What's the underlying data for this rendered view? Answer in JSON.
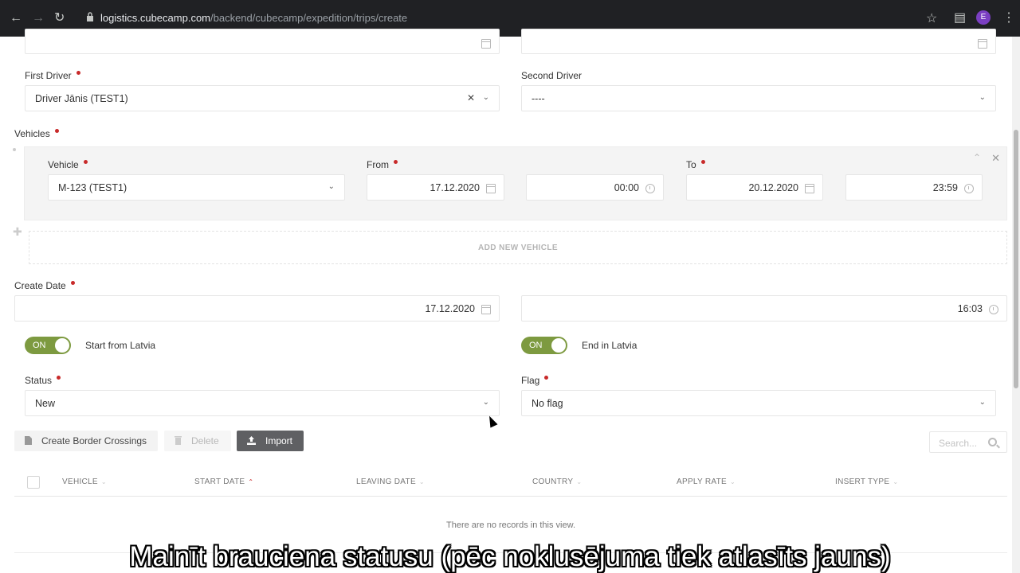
{
  "browser": {
    "url_host": "logistics.cubecamp.com",
    "url_path": "/backend/cubecamp/expedition/trips/create",
    "profile_initial": "E"
  },
  "form": {
    "first_driver": {
      "label": "First Driver",
      "value": "Driver Jānis (TEST1)"
    },
    "second_driver": {
      "label": "Second Driver",
      "value": "----"
    },
    "vehicles_label": "Vehicles",
    "vehicle": {
      "label": "Vehicle",
      "value": "M-123 (TEST1)"
    },
    "from": {
      "label": "From",
      "date": "17.12.2020",
      "time": "00:00"
    },
    "to": {
      "label": "To",
      "date": "20.12.2020",
      "time": "23:59"
    },
    "add_vehicle_label": "ADD NEW VEHICLE",
    "create_date": {
      "label": "Create Date",
      "date": "17.12.2020",
      "time": "16:03"
    },
    "start_from_latvia": {
      "toggle": "ON",
      "label": "Start from Latvia"
    },
    "end_in_latvia": {
      "toggle": "ON",
      "label": "End in Latvia"
    },
    "status": {
      "label": "Status",
      "value": "New"
    },
    "flag": {
      "label": "Flag",
      "value": "No flag"
    }
  },
  "toolbar": {
    "create_border_crossings": "Create Border Crossings",
    "delete": "Delete",
    "import": "Import",
    "search_placeholder": "Search..."
  },
  "table": {
    "columns": [
      "VEHICLE",
      "START DATE",
      "LEAVING DATE",
      "COUNTRY",
      "APPLY RATE",
      "INSERT TYPE"
    ],
    "empty_message": "There are no records in this view."
  },
  "subtitle": "Mainīt brauciena statusu (pēc noklusējuma tiek atlasīts jauns)",
  "colors": {
    "accent_green": "#7d9a40",
    "required_dot": "#c82a2a",
    "import_button": "#5f6063"
  }
}
